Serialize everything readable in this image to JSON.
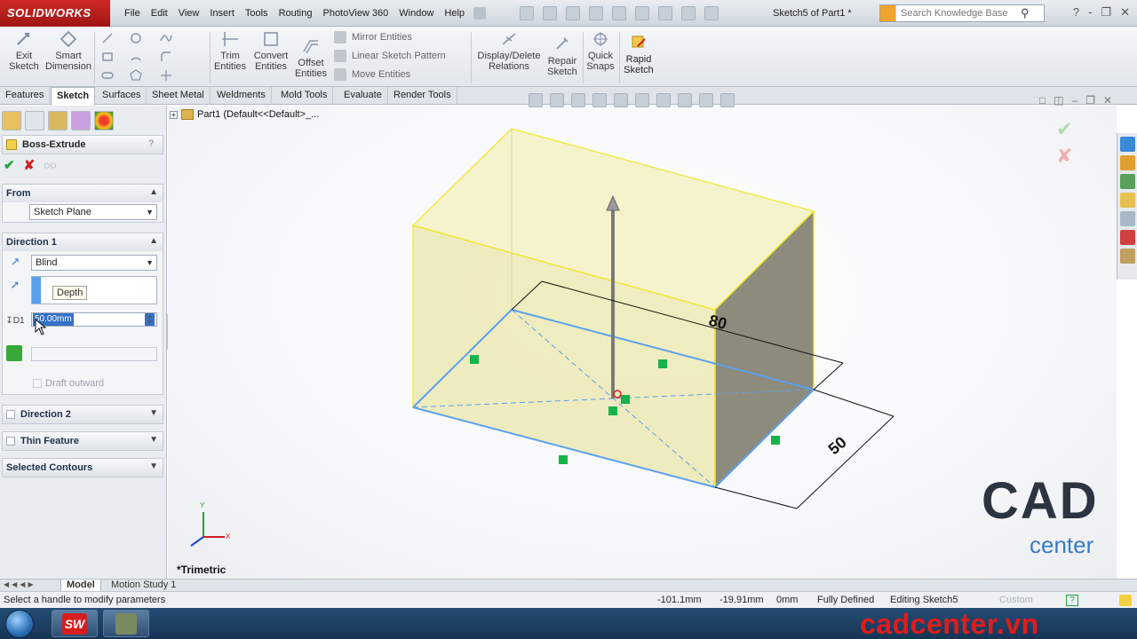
{
  "app": {
    "logo_text": "SOLIDWORKS",
    "document_title": "Sketch5 of Part1 *",
    "menu": [
      "File",
      "Edit",
      "View",
      "Insert",
      "Tools",
      "Routing",
      "PhotoView 360",
      "Window",
      "Help"
    ],
    "search": {
      "placeholder": "Search Knowledge Base"
    },
    "window_controls": [
      "?",
      "-",
      "❐",
      "✕"
    ]
  },
  "command_manager": {
    "exit_sketch": "Exit\nSketch",
    "smart_dimension": "Smart\nDimension",
    "trim_entities": "Trim\nEntities",
    "convert_entities": "Convert\nEntities",
    "offset_entities": "Offset\nEntities",
    "mirror_entities": "Mirror Entities",
    "linear_sketch_pattern": "Linear Sketch Pattern",
    "move_entities": "Move Entities",
    "display_delete_relations": "Display/Delete\nRelations",
    "repair_sketch": "Repair\nSketch",
    "quick_snaps": "Quick\nSnaps",
    "rapid_sketch": "Rapid\nSketch"
  },
  "tabs": [
    "Features",
    "Sketch",
    "Surfaces",
    "Sheet Metal",
    "Weldments",
    "Mold Tools",
    "Evaluate",
    "Render Tools"
  ],
  "active_tab": "Sketch",
  "property_manager": {
    "title": "Boss-Extrude",
    "help": "?",
    "from": {
      "header": "From",
      "value": "Sketch Plane"
    },
    "direction1": {
      "header": "Direction 1",
      "end_condition": "Blind",
      "depth_tooltip": "Depth",
      "depth_value": "50.00mm",
      "draft_outward": "Draft outward"
    },
    "direction2": {
      "header": "Direction 2"
    },
    "thin_feature": {
      "header": "Thin Feature"
    },
    "selected_contours": {
      "header": "Selected Contours"
    }
  },
  "viewport": {
    "tree_item": "Part1  (Default<<Default>_...",
    "view_name": "*Trimetric",
    "dimension_length": "80",
    "dimension_width": "50",
    "logo_text": "CAD",
    "logo_sub": "center",
    "triad_axes": {
      "x": "X",
      "y": "Y"
    }
  },
  "bottom_tabs": [
    "Model",
    "Motion Study 1"
  ],
  "status_bar": {
    "message": "Select a handle to modify parameters",
    "x": "-101.1mm",
    "y": "-19.91mm",
    "z": "0mm",
    "sketch_state": "Fully Defined",
    "editing": "Editing Sketch5",
    "units": "Custom",
    "help": "?"
  },
  "taskbar": {
    "sw_app_label": "SW",
    "watermark": "cadcenter.vn"
  },
  "colors": {
    "accent_red": "#d12020",
    "ok_green": "#24a140",
    "sketch_blue": "#5aa0ee",
    "body_yellow": "#f2eeb0",
    "edge_yellow": "#f0e93a"
  }
}
